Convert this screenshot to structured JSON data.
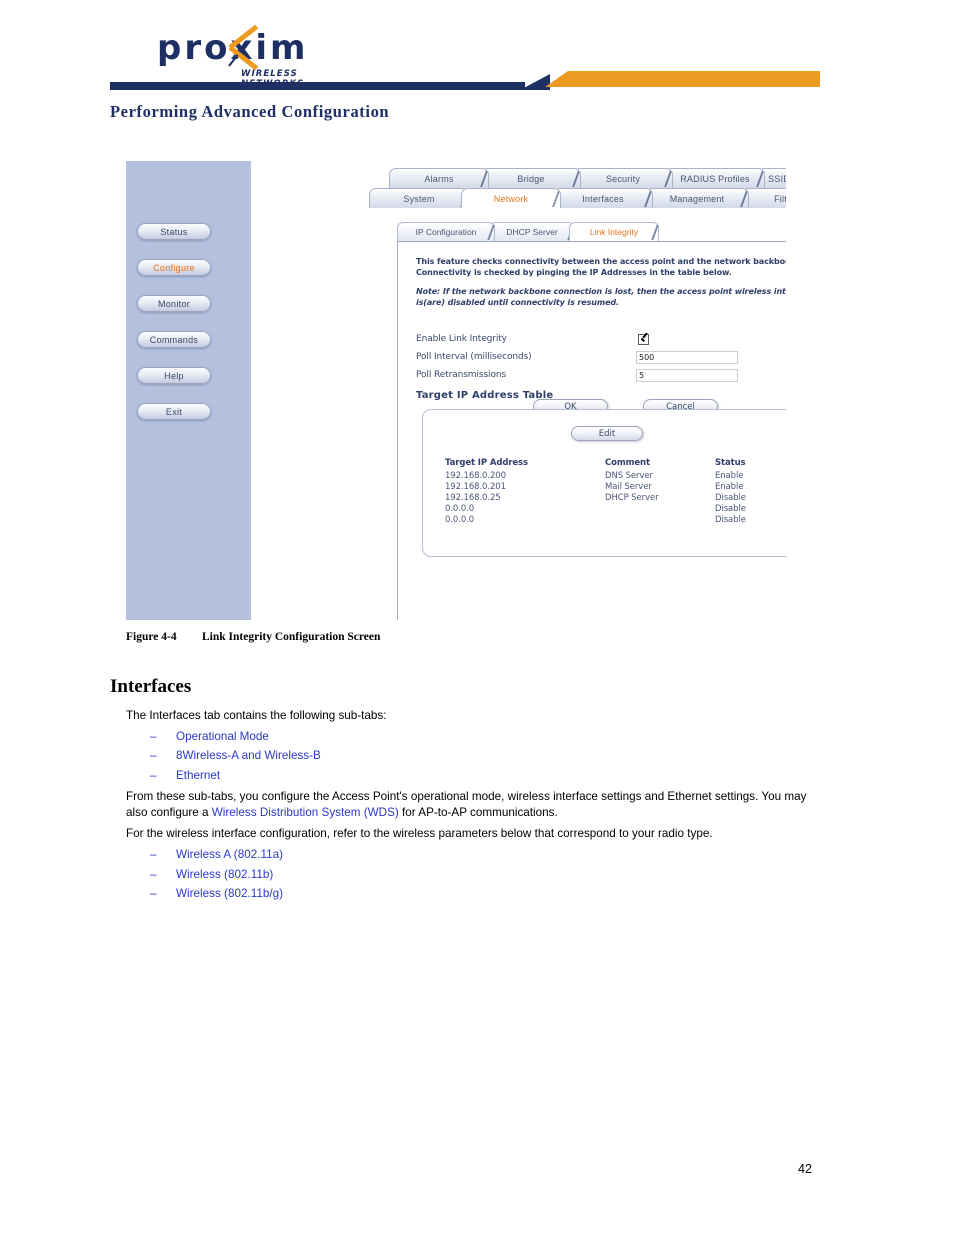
{
  "header": {
    "logo_word": "proxim",
    "logo_tagline": "WIRELESS NETWORKS",
    "chapter_title": "Performing Advanced Configuration",
    "colors": {
      "navy": "#1d2f63",
      "orange": "#ec9a21"
    }
  },
  "screenshot": {
    "sidebar": {
      "buttons": [
        {
          "label": "Status",
          "active": false
        },
        {
          "label": "Configure",
          "active": true
        },
        {
          "label": "Monitor",
          "active": false
        },
        {
          "label": "Commands",
          "active": false
        },
        {
          "label": "Help",
          "active": false
        },
        {
          "label": "Exit",
          "active": false
        }
      ]
    },
    "tabs_top": [
      {
        "label": "Alarms",
        "active": false
      },
      {
        "label": "Bridge",
        "active": false
      },
      {
        "label": "Security",
        "active": false
      },
      {
        "label": "RADIUS Profiles",
        "active": false
      },
      {
        "label": "SSID/VLAN/Security",
        "active": false
      }
    ],
    "tabs_mid": [
      {
        "label": "System",
        "active": false
      },
      {
        "label": "Network",
        "active": true
      },
      {
        "label": "Interfaces",
        "active": false
      },
      {
        "label": "Management",
        "active": false
      },
      {
        "label": "Filtering",
        "active": false
      }
    ],
    "subtabs": [
      {
        "label": "IP Configuration",
        "active": false
      },
      {
        "label": "DHCP Server",
        "active": false
      },
      {
        "label": "Link Integrity",
        "active": true
      }
    ],
    "panel": {
      "description": "This feature checks connectivity between the access point and the network backbone. Connectivity is checked by pinging the IP Addresses in the table below.",
      "note": "Note: If the network backbone connection is lost, then the access point wireless interface(s) is(are) disabled until connectivity is resumed.",
      "fields": {
        "enable_label": "Enable Link Integrity",
        "enable_checked": true,
        "poll_interval_label": "Poll Interval (milliseconds)",
        "poll_interval_value": "500",
        "poll_retrans_label": "Poll Retransmissions",
        "poll_retrans_value": "5"
      },
      "ok_label": "OK",
      "cancel_label": "Cancel",
      "table_heading": "Target IP Address Table",
      "edit_label": "Edit",
      "table_headers": [
        "Target IP Address",
        "Comment",
        "Status"
      ],
      "table_rows": [
        [
          "192.168.0.200",
          "DNS Server",
          "Enable"
        ],
        [
          "192.168.0.201",
          "Mail Server",
          "Enable"
        ],
        [
          "192.168.0.25",
          "DHCP Server",
          "Disable"
        ],
        [
          "0.0.0.0",
          "",
          "Disable"
        ],
        [
          "0.0.0.0",
          "",
          "Disable"
        ]
      ]
    }
  },
  "document": {
    "figure_number": "Figure 4-4",
    "figure_caption": "Link Integrity Configuration Screen",
    "section_heading": "Interfaces",
    "intro": "The Interfaces tab contains the following sub-tabs:",
    "sub_tabs_list": [
      "Operational Mode",
      "8Wireless-A and Wireless-B",
      "Ethernet"
    ],
    "paragraph2_a": "From these sub-tabs, you configure the Access Point's operational mode, wireless interface settings and Ethernet settings. You may also configure a ",
    "paragraph2_link": "Wireless Distribution System (WDS)",
    "paragraph2_b": " for AP-to-AP communications.",
    "paragraph3": "For the wireless interface configuration, refer to the wireless parameters below that correspond to your radio type.",
    "radio_list": [
      "Wireless A (802.11a)",
      "Wireless (802.11b)",
      "Wireless (802.11b/g)"
    ],
    "page_number": "42"
  }
}
